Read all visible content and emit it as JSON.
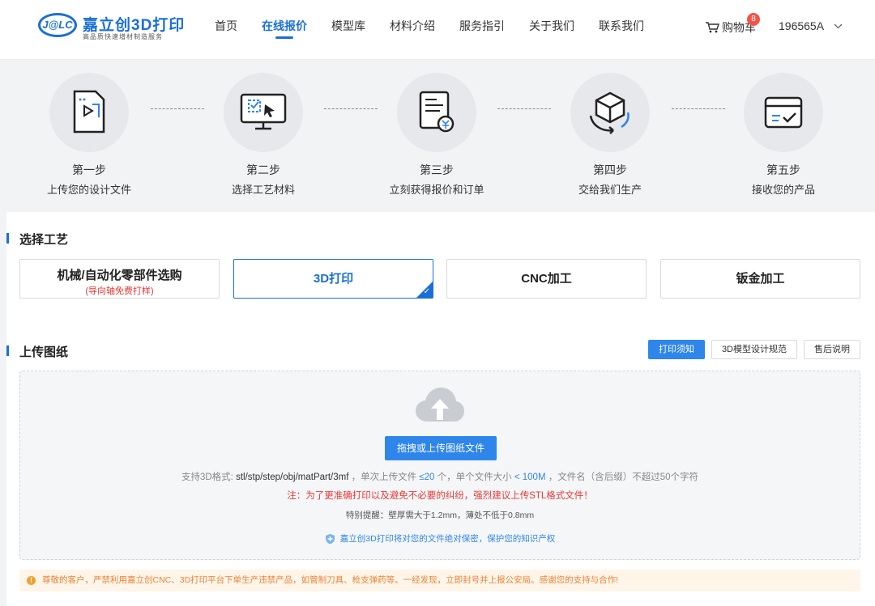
{
  "header": {
    "logo_badge": "J@LC",
    "logo_title": "嘉立创3D打印",
    "logo_subtitle": "高品质快速增材制造服务",
    "nav": [
      {
        "label": "首页"
      },
      {
        "label": "在线报价",
        "active": true
      },
      {
        "label": "模型库"
      },
      {
        "label": "材料介绍"
      },
      {
        "label": "服务指引"
      },
      {
        "label": "关于我们"
      },
      {
        "label": "联系我们"
      }
    ],
    "cart_label": "购物车",
    "cart_count": "8",
    "user_name": "196565A"
  },
  "steps": [
    {
      "title": "第一步",
      "desc": "上传您的设计文件",
      "icon": "file-upload-icon"
    },
    {
      "title": "第二步",
      "desc": "选择工艺材料",
      "icon": "monitor-select-icon"
    },
    {
      "title": "第三步",
      "desc": "立刻获得报价和订单",
      "icon": "quote-order-icon"
    },
    {
      "title": "第四步",
      "desc": "交给我们生产",
      "icon": "production-cube-icon"
    },
    {
      "title": "第五步",
      "desc": "接收您的产品",
      "icon": "receive-box-icon"
    }
  ],
  "process": {
    "title": "选择工艺",
    "options": [
      {
        "label": "机械/自动化零部件选购",
        "note": "(导向轴免费打样)"
      },
      {
        "label": "3D打印",
        "selected": true
      },
      {
        "label": "CNC加工"
      },
      {
        "label": "钣金加工"
      }
    ]
  },
  "upload": {
    "title": "上传图纸",
    "tabs": [
      {
        "label": "打印须知",
        "active": true
      },
      {
        "label": "3D模型设计规范"
      },
      {
        "label": "售后说明"
      }
    ],
    "button_label": "拖拽或上传图纸文件",
    "formats_prefix": "支持3D格式:",
    "formats_value": "stl/stp/step/obj/matPart/3mf",
    "formats_count_prefix": "，单次上传文件",
    "formats_count": "≤20",
    "formats_size_prefix": "个，单个文件大小",
    "formats_size": "< 100M",
    "formats_suffix": "，文件名（含后缀）不超过50个字符",
    "warning": "注：为了更准确打印以及避免不必要的纠纷，强烈建议上传STL格式文件！",
    "tip": "特别提醒：壁厚需大于1.2mm，薄处不低于0.8mm",
    "secure_note": "嘉立创3D打印将对您的文件绝对保密，保护您的知识产权"
  },
  "notice": "尊敬的客户，严禁利用嘉立创CNC、3D打印平台下单生产违禁产品，如管制刀具、枪支弹药等。一经发现，立即封号并上报公安局。感谢您的支持与合作!",
  "colors": {
    "accent": "#2f86ea",
    "danger": "#e53935",
    "warning": "#e8833a"
  }
}
